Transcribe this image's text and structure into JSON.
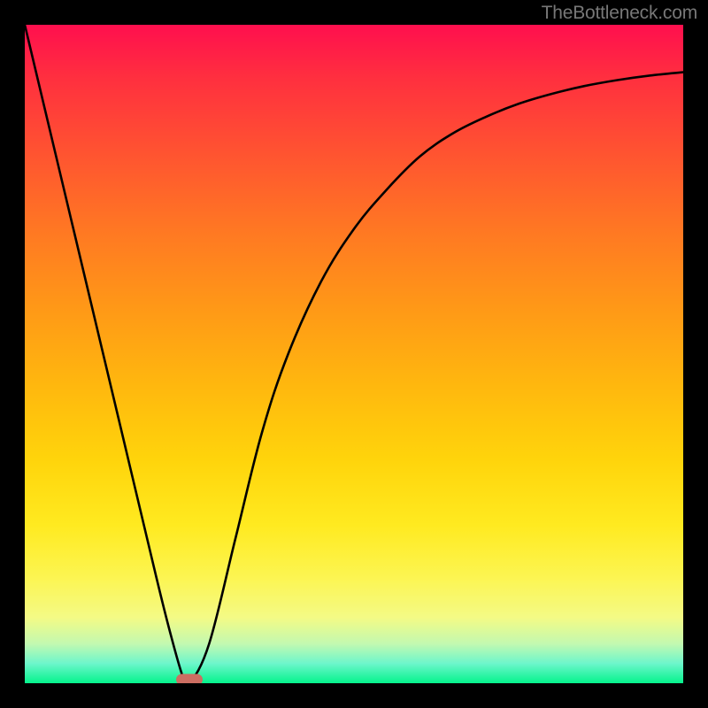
{
  "watermark": "TheBottleneck.com",
  "chart_data": {
    "type": "line",
    "title": "",
    "xlabel": "",
    "ylabel": "",
    "xlim": [
      0,
      100
    ],
    "ylim": [
      0,
      100
    ],
    "series": [
      {
        "name": "curve",
        "x": [
          0,
          5,
          10,
          15,
          20,
          22,
          24,
          25,
          28,
          32,
          36,
          40,
          45,
          50,
          55,
          60,
          65,
          70,
          75,
          80,
          85,
          90,
          95,
          100
        ],
        "values": [
          100,
          79,
          58,
          37,
          16,
          8,
          1,
          0,
          6,
          22,
          38,
          50,
          61,
          69,
          75,
          80,
          83.5,
          86,
          88,
          89.5,
          90.7,
          91.6,
          92.3,
          92.8
        ]
      }
    ],
    "marker": {
      "x": 25,
      "y": 0
    },
    "background_gradient": {
      "top_color": "#ff0f4e",
      "mid_color": "#ffd40b",
      "bottom_color": "#05f38c"
    },
    "curve_min_x": 25
  }
}
